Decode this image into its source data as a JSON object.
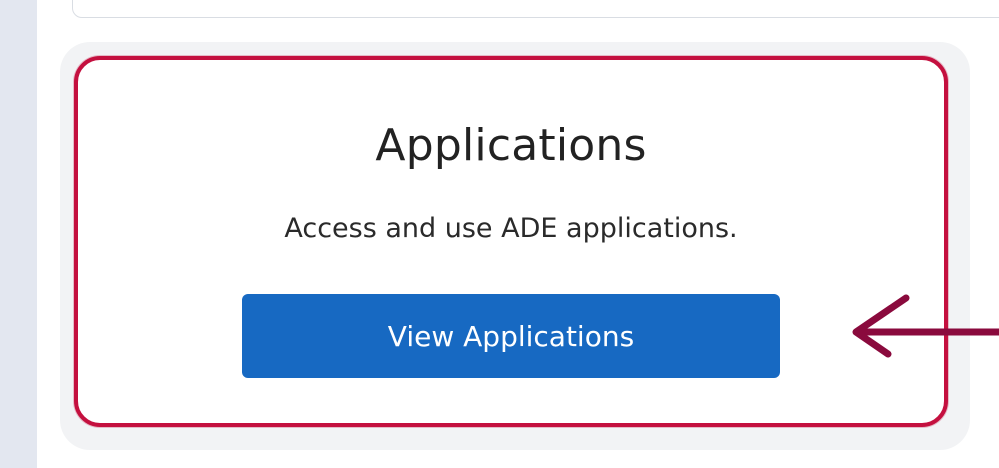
{
  "card": {
    "title": "Applications",
    "description": "Access and use ADE applications.",
    "button_label": "View Applications"
  },
  "colors": {
    "page_background": "#e3e7f0",
    "highlight_border": "#c4103f",
    "button_background": "#1769c2",
    "button_text": "#ffffff",
    "arrow": "#8a0a3d"
  },
  "annotations": {
    "arrow_icon": "arrow-left-icon"
  }
}
